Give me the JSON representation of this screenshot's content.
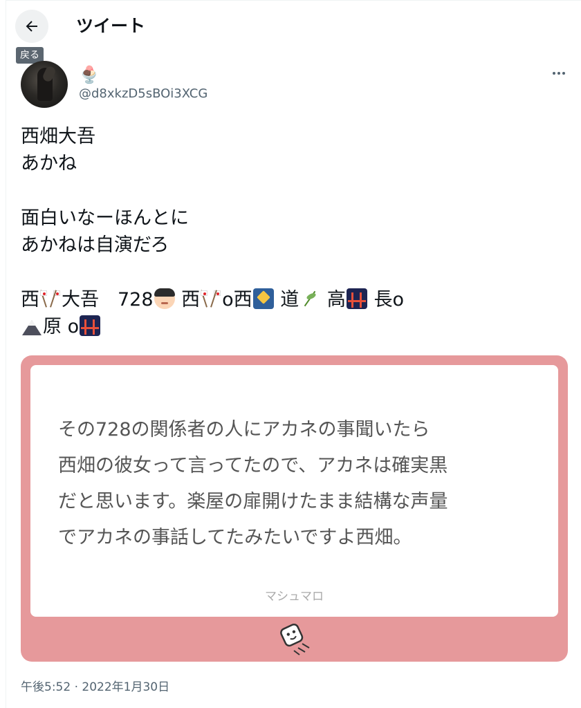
{
  "header": {
    "title": "ツイート",
    "back_tooltip": "戻る"
  },
  "author": {
    "display_name": "🍨",
    "handle": "@d8xkzD5sBOi3XCG"
  },
  "tweet": {
    "lines": [
      "西畑大吾",
      "あかね",
      "面白いなーほんとに",
      "あかねは自演だろ"
    ],
    "emoji_line_1": {
      "t1": "西",
      "t2": "大吾　728",
      "t3": " 西",
      "t4": "o西",
      "t5": " 道",
      "t6": " 高",
      "t7": " 長o"
    },
    "emoji_line_2": {
      "t1": "原 o"
    },
    "icons": [
      "japanese-flags-icon",
      "boy-face-icon",
      "shooting-star-icon",
      "herb-icon",
      "bridge-at-night-icon",
      "mount-fuji-icon"
    ]
  },
  "card": {
    "lines": [
      "その728の関係者の人にアカネの事聞いたら",
      "西畑の彼女って言ってたので、アカネは確実黒",
      "だと思います。楽屋の扉開けたまま結構な声量",
      "でアカネの事話してたみたいですよ西畑。"
    ],
    "source": "マシュマロ",
    "bg_color": "#e6999b"
  },
  "timestamp": "午後5:52 · 2022年1月30日"
}
